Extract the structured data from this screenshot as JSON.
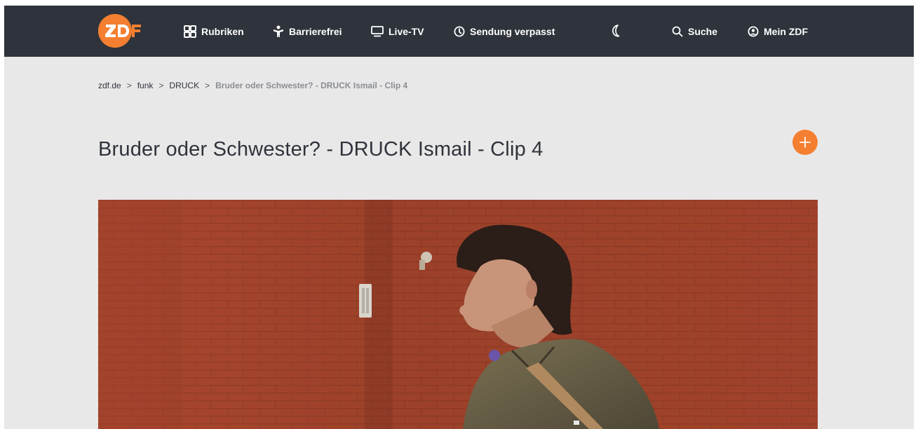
{
  "brand": {
    "logo_text": "ZDF",
    "accent_color": "#f47f30",
    "header_bg": "#2f333b"
  },
  "nav": {
    "rubriken": {
      "label": "Rubriken",
      "icon": "grid-icon"
    },
    "barrierefrei": {
      "label": "Barrierefrei",
      "icon": "accessibility-icon"
    },
    "live_tv": {
      "label": "Live-TV",
      "icon": "tv-icon"
    },
    "sendung_verpasst": {
      "label": "Sendung verpasst",
      "icon": "clock-icon"
    },
    "theme_toggle": {
      "icon": "moon-icon"
    },
    "suche": {
      "label": "Suche",
      "icon": "search-icon"
    },
    "mein_zdf": {
      "label": "Mein ZDF",
      "icon": "user-icon"
    }
  },
  "breadcrumb": {
    "items": [
      "zdf.de",
      "funk",
      "DRUCK"
    ],
    "current": "Bruder oder Schwester? - DRUCK Ismail - Clip 4"
  },
  "page": {
    "title": "Bruder oder Schwester? - DRUCK Ismail - Clip 4",
    "add_icon": "plus-icon"
  },
  "video": {
    "thumbnail": "video-thumbnail"
  }
}
